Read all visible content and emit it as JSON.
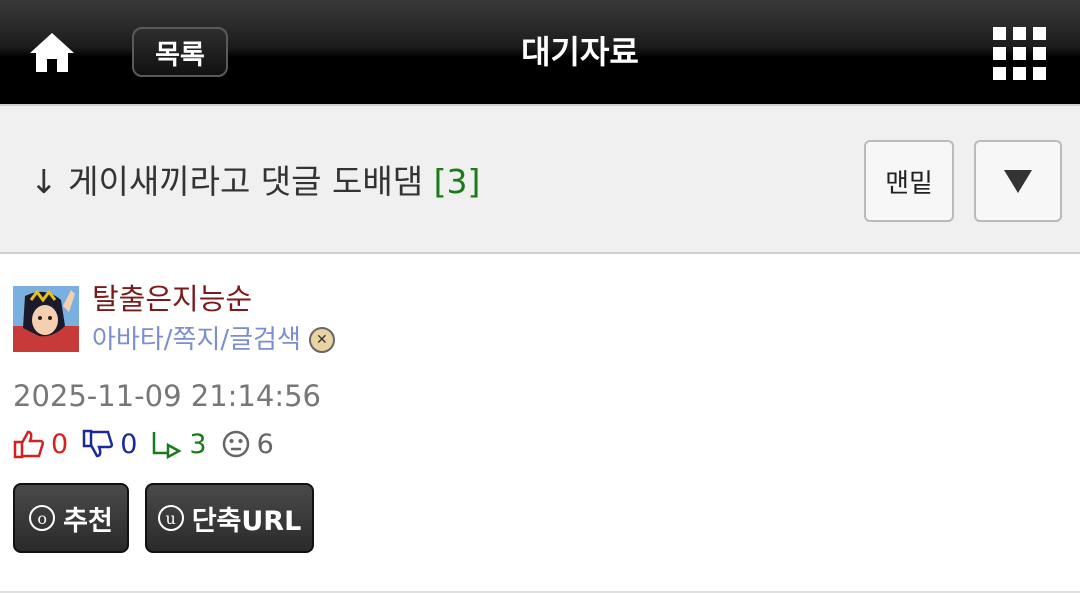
{
  "header": {
    "home_icon": "home-icon",
    "list_button": "목록",
    "title": "대기자료",
    "menu_icon": "grid-menu-icon"
  },
  "post": {
    "arrow": "↓",
    "subject": "게이새끼라고 댓글 도배댐",
    "comment_count": "[3]",
    "bottom_button": "맨밑",
    "toggle_icon": "triangle-down-icon"
  },
  "author": {
    "nickname": "탈출은지능순",
    "links": "아바타/쪽지/글검색",
    "date": "2025-11-09 21:14:56"
  },
  "stats": {
    "likes": "0",
    "dislikes": "0",
    "comments": "3",
    "views": "6"
  },
  "actions": {
    "recommend_key": "o",
    "recommend_label": "추천",
    "shorturl_key": "u",
    "shorturl_label": "단축URL"
  },
  "colors": {
    "like": "#d42020",
    "dislike": "#1a2a9a",
    "comment": "#1a7a1a",
    "views": "#666666",
    "nickname": "#7a1a1a",
    "links": "#7a8ed0"
  }
}
